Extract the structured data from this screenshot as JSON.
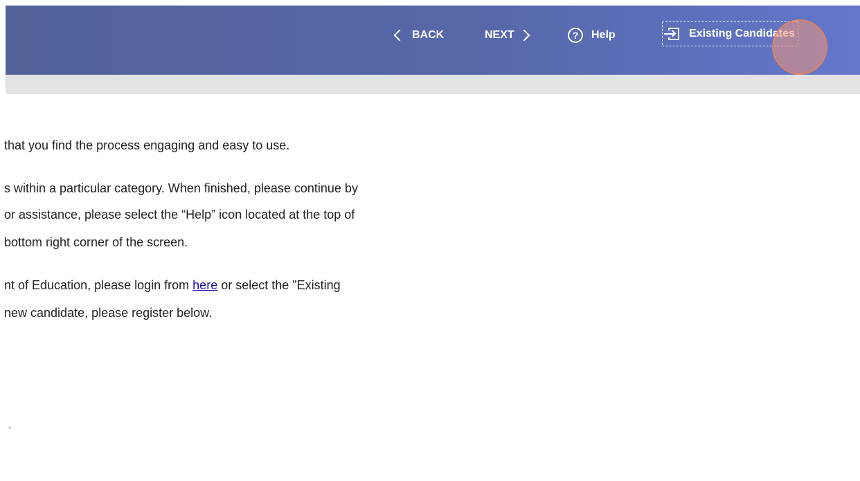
{
  "header": {
    "back_label": "BACK",
    "next_label": "NEXT",
    "help_label": "Help",
    "help_glyph": "?",
    "existing_label": "Existing Candidates"
  },
  "content": {
    "p1": {
      "line1": "that you find the process engaging and easy to use."
    },
    "p2": {
      "line1": "s within a particular category. When finished, please continue by",
      "line2": "or assistance, please select the “Help” icon located at the top of",
      "line3": "bottom right corner of the screen."
    },
    "p3": {
      "line1_before": "nt of Education, please login from ",
      "link": "here",
      "line1_after": " or select the \"Existing",
      "line2": "new candidate, please register below."
    }
  },
  "icons": {
    "back": "chevron-left-icon",
    "next": "chevron-right-icon",
    "help": "help-circle-icon",
    "existing": "login-icon"
  },
  "colors": {
    "header_start": "#52639a",
    "header_end": "#6377cc",
    "link": "#1a0dab",
    "click_marker": "#f0967a"
  }
}
